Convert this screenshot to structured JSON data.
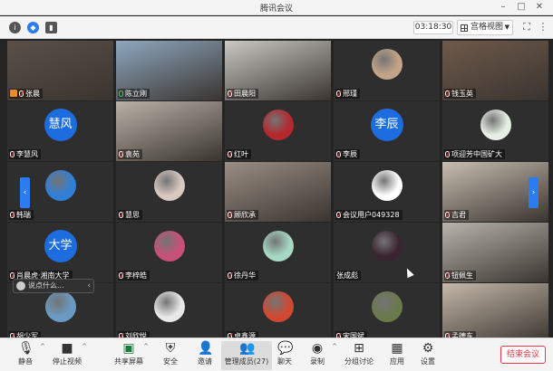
{
  "window": {
    "title": "腾讯会议"
  },
  "topbar": {
    "timer": "03:18:30",
    "view_label": "宫格视图"
  },
  "tiles": [
    {
      "name": "张晨",
      "kind": "video",
      "bg": "#5a5048",
      "host": true,
      "mic": "off"
    },
    {
      "name": "陈立刚",
      "kind": "video",
      "bg": "#8ea8bf",
      "mic": "on"
    },
    {
      "name": "田晨阳",
      "kind": "video",
      "bg": "#c9c9c4",
      "mic": "off"
    },
    {
      "name": "邢瑾",
      "kind": "avatar",
      "bg": "#2e2e2e",
      "avatar_color": "#c4a488",
      "mic": "off"
    },
    {
      "name": "钱玉英",
      "kind": "video",
      "bg": "#6e5a4a",
      "mic": "off"
    },
    {
      "name": "李慧风",
      "kind": "text",
      "initials": "慧风",
      "mic": "off"
    },
    {
      "name": "袁苑",
      "kind": "video",
      "bg": "#b9b2a8",
      "mic": "off"
    },
    {
      "name": "红叶",
      "kind": "avatar",
      "avatar_color": "#b4282e",
      "mic": "off"
    },
    {
      "name": "李辰",
      "kind": "text",
      "initials": "李辰",
      "mic": "off"
    },
    {
      "name": "项迎芳中国矿大",
      "kind": "avatar",
      "avatar_color": "#e6efe4",
      "mic": "off"
    },
    {
      "name": "韩瑞",
      "kind": "avatar",
      "avatar_color": "#2f7fd8",
      "mic": "off"
    },
    {
      "name": "慧思",
      "kind": "avatar",
      "avatar_color": "#d8c8c0",
      "mic": "off"
    },
    {
      "name": "顾欣承",
      "kind": "video",
      "bg": "#9a8e84",
      "mic": "off"
    },
    {
      "name": "会议用户049328",
      "kind": "avatar",
      "avatar_color": "#ffffff",
      "mic": "off"
    },
    {
      "name": "吉君",
      "kind": "video",
      "bg": "#c8beb0",
      "mic": "off"
    },
    {
      "name": "肖晨虎·湘南大学",
      "kind": "text",
      "initials": "大学",
      "mic": "off"
    },
    {
      "name": "李梓皓",
      "kind": "avatar",
      "avatar_color": "#c85078",
      "mic": "off"
    },
    {
      "name": "徐丹华",
      "kind": "avatar",
      "avatar_color": "#a6d8c4",
      "mic": "off"
    },
    {
      "name": "张成彪",
      "kind": "avatar",
      "avatar_color": "#3a2430",
      "mic": "none"
    },
    {
      "name": "钮佩生",
      "kind": "video",
      "bg": "#b8b4ac",
      "mic": "off"
    },
    {
      "name": "胡少军",
      "kind": "avatar",
      "avatar_color": "#6a9ac4",
      "mic": "off"
    },
    {
      "name": "刘欣悦",
      "kind": "avatar",
      "avatar_color": "#e8e8e8",
      "mic": "off"
    },
    {
      "name": "卓鑫源",
      "kind": "avatar",
      "avatar_color": "#d04830",
      "mic": "off"
    },
    {
      "name": "宋国斌",
      "kind": "avatar",
      "avatar_color": "#6a7a4a",
      "mic": "off"
    },
    {
      "name": "孟德东",
      "kind": "video",
      "bg": "#c4b8a8",
      "mic": "off"
    }
  ],
  "chat_popup": {
    "text": "说点什么..."
  },
  "toolbar": {
    "mute": "静音",
    "stop_video": "停止视频",
    "share": "共享屏幕",
    "security": "安全",
    "invite": "邀请",
    "members": "管理成员(27)",
    "chat": "聊天",
    "record": "录制",
    "breakout": "分组讨论",
    "apps": "应用",
    "settings": "设置",
    "end": "结束会议"
  }
}
